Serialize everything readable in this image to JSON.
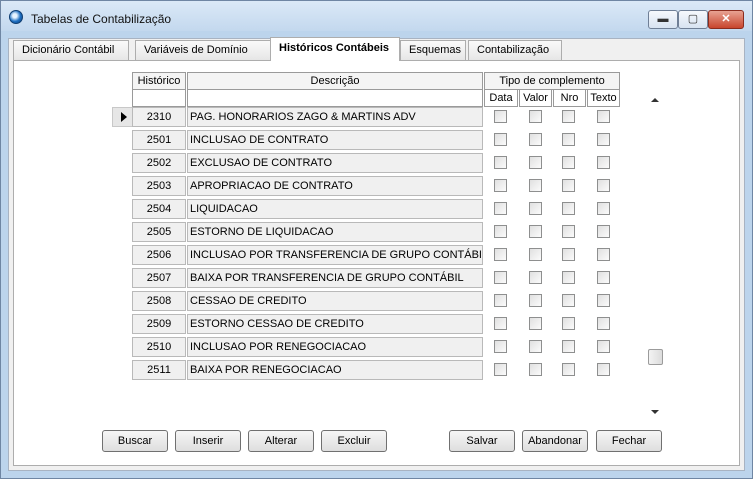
{
  "window": {
    "title": "Tabelas de Contabilização"
  },
  "caption_buttons": {
    "minimize": "▬",
    "maximize": "▢",
    "close": "✕"
  },
  "tabs": [
    {
      "label": "Dicionário Contábil"
    },
    {
      "label": "Variáveis de Domínio"
    },
    {
      "label": "Históricos Contábeis"
    },
    {
      "label": "Esquemas"
    },
    {
      "label": "Contabilização"
    }
  ],
  "grid": {
    "col_historico": "Histórico",
    "col_descricao": "Descrição",
    "col_tipo": "Tipo de complemento",
    "sub_data": "Data",
    "sub_valor": "Valor",
    "sub_nro": "Nro",
    "sub_texto": "Texto",
    "rows": [
      {
        "code": "2310",
        "desc": "PAG. HONORARIOS ZAGO & MARTINS ADV"
      },
      {
        "code": "2501",
        "desc": "INCLUSAO DE CONTRATO"
      },
      {
        "code": "2502",
        "desc": "EXCLUSAO DE CONTRATO"
      },
      {
        "code": "2503",
        "desc": "APROPRIACAO DE CONTRATO"
      },
      {
        "code": "2504",
        "desc": "LIQUIDACAO"
      },
      {
        "code": "2505",
        "desc": "ESTORNO DE LIQUIDACAO"
      },
      {
        "code": "2506",
        "desc": "INCLUSAO POR TRANSFERENCIA DE GRUPO CONTÁBIL"
      },
      {
        "code": "2507",
        "desc": "BAIXA POR TRANSFERENCIA DE GRUPO CONTÁBIL"
      },
      {
        "code": "2508",
        "desc": "CESSAO DE CREDITO"
      },
      {
        "code": "2509",
        "desc": "ESTORNO CESSAO DE CREDITO"
      },
      {
        "code": "2510",
        "desc": "INCLUSAO POR RENEGOCIACAO"
      },
      {
        "code": "2511",
        "desc": "BAIXA POR RENEGOCIACAO"
      }
    ]
  },
  "buttons": {
    "buscar": "Buscar",
    "inserir": "Inserir",
    "alterar": "Alterar",
    "excluir": "Excluir",
    "salvar": "Salvar",
    "abandonar": "Abandonar",
    "fechar": "Fechar"
  }
}
